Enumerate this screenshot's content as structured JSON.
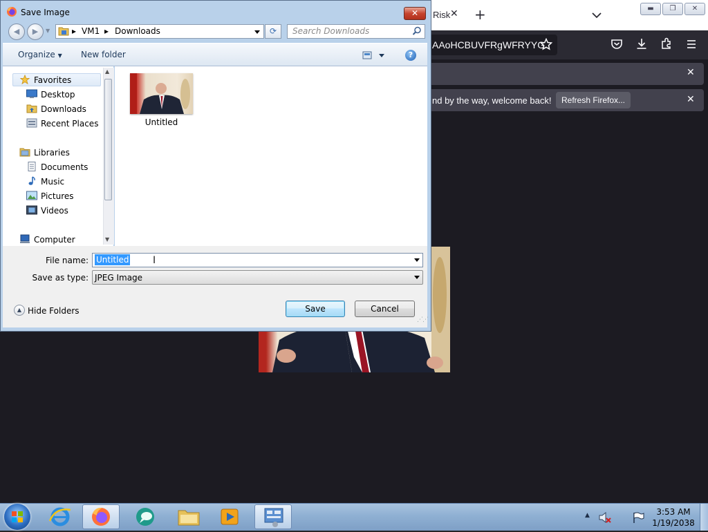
{
  "browser": {
    "tab_partial": "Risk",
    "url_partial": "AAoHCBUVFRgWFRYYG",
    "notification_text": "nd by the way, welcome back!",
    "refresh_button": "Refresh Firefox..."
  },
  "dialog": {
    "title": "Save Image",
    "breadcrumb": [
      "VM1",
      "Downloads"
    ],
    "search_placeholder": "Search Downloads",
    "toolbar": {
      "organize": "Organize",
      "new_folder": "New folder"
    },
    "nav": {
      "favorites": "Favorites",
      "favorites_items": [
        "Desktop",
        "Downloads",
        "Recent Places"
      ],
      "libraries": "Libraries",
      "libraries_items": [
        "Documents",
        "Music",
        "Pictures",
        "Videos"
      ],
      "computer": "Computer"
    },
    "files": [
      {
        "name": "Untitled"
      }
    ],
    "file_name_label": "File name:",
    "file_name_value": "Untitled",
    "save_type_label": "Save as type:",
    "save_type_value": "JPEG Image",
    "hide_folders": "Hide Folders",
    "save_button": "Save",
    "cancel_button": "Cancel"
  },
  "taskbar": {
    "apps": [
      "start",
      "internet-explorer",
      "firefox",
      "chat-app",
      "file-explorer",
      "media-player",
      "control-panel"
    ],
    "clock_time": "3:53 AM",
    "clock_date": "1/19/2038"
  },
  "colors": {
    "selection": "#3399ff",
    "dialog_frame": "#b9d1ea",
    "firefox_dark": "#1c1b22"
  }
}
